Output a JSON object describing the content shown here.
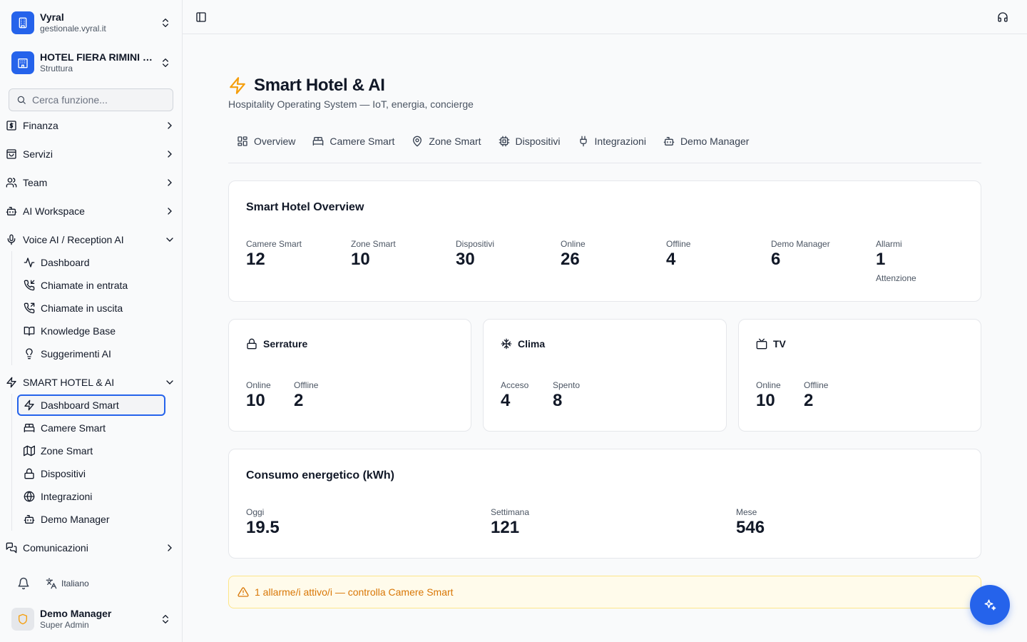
{
  "workspace": {
    "name": "Vyral",
    "domain": "gestionale.vyral.it",
    "icon": "building-icon"
  },
  "property": {
    "name": "HOTEL FIERA RIMINI …",
    "type": "Struttura",
    "icon": "hotel-icon"
  },
  "search": {
    "placeholder": "Cerca funzione..."
  },
  "sidebar": {
    "sections": [
      {
        "label": "Finanza",
        "icon": "dollar-icon",
        "expanded": false
      },
      {
        "label": "Servizi",
        "icon": "bag-icon",
        "expanded": false
      },
      {
        "label": "Team",
        "icon": "users-icon",
        "expanded": false
      },
      {
        "label": "AI Workspace",
        "icon": "bot-icon",
        "expanded": false
      },
      {
        "label": "Voice AI / Reception AI",
        "icon": "mic-icon",
        "expanded": true
      },
      {
        "label": "SMART HOTEL & AI",
        "icon": "zap-icon",
        "expanded": true
      },
      {
        "label": "Comunicazioni",
        "icon": "messages-icon",
        "expanded": false
      }
    ],
    "voice_items": [
      {
        "label": "Dashboard",
        "icon": "activity-icon"
      },
      {
        "label": "Chiamate in entrata",
        "icon": "phone-incoming-icon"
      },
      {
        "label": "Chiamate in uscita",
        "icon": "phone-outgoing-icon"
      },
      {
        "label": "Knowledge Base",
        "icon": "book-icon"
      },
      {
        "label": "Suggerimenti AI",
        "icon": "lightbulb-icon"
      }
    ],
    "smart_items": [
      {
        "label": "Dashboard Smart",
        "icon": "zap-icon",
        "active": true
      },
      {
        "label": "Camere Smart",
        "icon": "bed-icon"
      },
      {
        "label": "Zone Smart",
        "icon": "map-icon"
      },
      {
        "label": "Dispositivi",
        "icon": "lock-icon"
      },
      {
        "label": "Integrazioni",
        "icon": "globe-icon"
      },
      {
        "label": "Demo Manager",
        "icon": "bot-icon"
      }
    ]
  },
  "footer": {
    "language": "Italiano",
    "user_name": "Demo Manager",
    "user_role": "Super Admin"
  },
  "page": {
    "title": "Smart Hotel & AI",
    "subtitle": "Hospitality Operating System — IoT, energia, concierge",
    "accent": "#f59e0b"
  },
  "tabs": [
    {
      "label": "Overview",
      "icon": "grid-icon"
    },
    {
      "label": "Camere Smart",
      "icon": "bed-icon"
    },
    {
      "label": "Zone Smart",
      "icon": "map-pin-icon"
    },
    {
      "label": "Dispositivi",
      "icon": "cpu-icon"
    },
    {
      "label": "Integrazioni",
      "icon": "plug-icon"
    },
    {
      "label": "Demo Manager",
      "icon": "bot-icon"
    }
  ],
  "overview": {
    "title": "Smart Hotel Overview",
    "stats": [
      {
        "label": "Camere Smart",
        "value": "12"
      },
      {
        "label": "Zone Smart",
        "value": "10"
      },
      {
        "label": "Dispositivi",
        "value": "30"
      },
      {
        "label": "Online",
        "value": "26"
      },
      {
        "label": "Offline",
        "value": "4"
      },
      {
        "label": "Demo Manager",
        "value": "6"
      },
      {
        "label": "Allarmi",
        "value": "1",
        "note": "Attenzione"
      }
    ]
  },
  "devices": [
    {
      "title": "Serrature",
      "icon": "lock-icon",
      "stats": [
        {
          "label": "Online",
          "value": "10"
        },
        {
          "label": "Offline",
          "value": "2"
        }
      ]
    },
    {
      "title": "Clima",
      "icon": "snowflake-icon",
      "stats": [
        {
          "label": "Acceso",
          "value": "4"
        },
        {
          "label": "Spento",
          "value": "8"
        }
      ]
    },
    {
      "title": "TV",
      "icon": "tv-icon",
      "stats": [
        {
          "label": "Online",
          "value": "10"
        },
        {
          "label": "Offline",
          "value": "2"
        }
      ]
    }
  ],
  "energy": {
    "title": "Consumo energetico (kWh)",
    "stats": [
      {
        "label": "Oggi",
        "value": "19.5"
      },
      {
        "label": "Settimana",
        "value": "121"
      },
      {
        "label": "Mese",
        "value": "546"
      }
    ]
  },
  "alert": {
    "text": "1 allarme/i attivo/i — controlla Camere Smart",
    "icon": "alert-triangle-icon"
  },
  "colors": {
    "primary": "#2563eb",
    "warning": "#d97706"
  }
}
